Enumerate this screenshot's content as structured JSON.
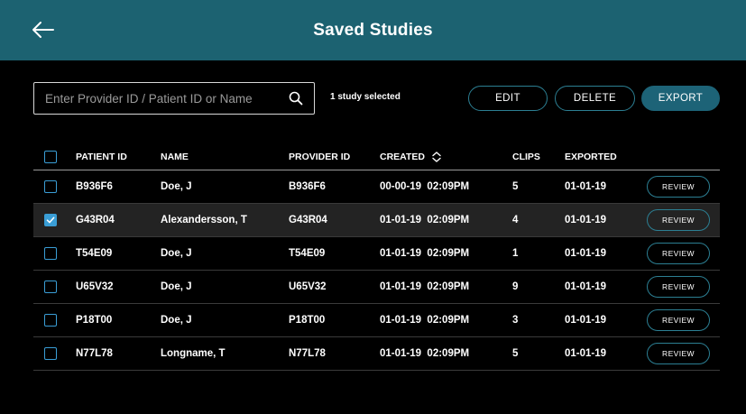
{
  "header": {
    "title": "Saved Studies",
    "back_icon": "arrow-left-icon",
    "color": "#1c6271"
  },
  "toolbar": {
    "search_placeholder": "Enter Provider ID / Patient ID or Name",
    "search_value": "",
    "search_icon": "search-icon",
    "selection_status": "1 study selected",
    "edit_label": "EDIT",
    "delete_label": "DELETE",
    "export_label": "EXPORT"
  },
  "table": {
    "columns": {
      "patient_id": "PATIENT ID",
      "name": "NAME",
      "provider_id": "PROVIDER ID",
      "created": "CREATED",
      "clips": "CLIPS",
      "exported": "EXPORTED"
    },
    "sort_icon": "sort-updown-icon",
    "rows": [
      {
        "patient_id": "B936F6",
        "name": "Doe, J",
        "provider_id": "B936F6",
        "created": "00-00-19  02:09PM",
        "clips": "5",
        "exported": "01-01-19",
        "action": "REVIEW",
        "checked": false
      },
      {
        "patient_id": "G43R04",
        "name": "Alexandersson, T",
        "provider_id": "G43R04",
        "created": "01-01-19  02:09PM",
        "clips": "4",
        "exported": "01-01-19",
        "action": "REVIEW",
        "checked": true
      },
      {
        "patient_id": "T54E09",
        "name": "Doe, J",
        "provider_id": "T54E09",
        "created": "01-01-19  02:09PM",
        "clips": "1",
        "exported": "01-01-19",
        "action": "REVIEW",
        "checked": false
      },
      {
        "patient_id": "U65V32",
        "name": "Doe, J",
        "provider_id": "U65V32",
        "created": "01-01-19  02:09PM",
        "clips": "9",
        "exported": "01-01-19",
        "action": "REVIEW",
        "checked": false
      },
      {
        "patient_id": "P18T00",
        "name": "Doe, J",
        "provider_id": "P18T00",
        "created": "01-01-19  02:09PM",
        "clips": "3",
        "exported": "01-01-19",
        "action": "REVIEW",
        "checked": false
      },
      {
        "patient_id": "N77L78",
        "name": "Longname, T",
        "provider_id": "N77L78",
        "created": "01-01-19  02:09PM",
        "clips": "5",
        "exported": "01-01-19",
        "action": "REVIEW",
        "checked": false
      }
    ]
  }
}
